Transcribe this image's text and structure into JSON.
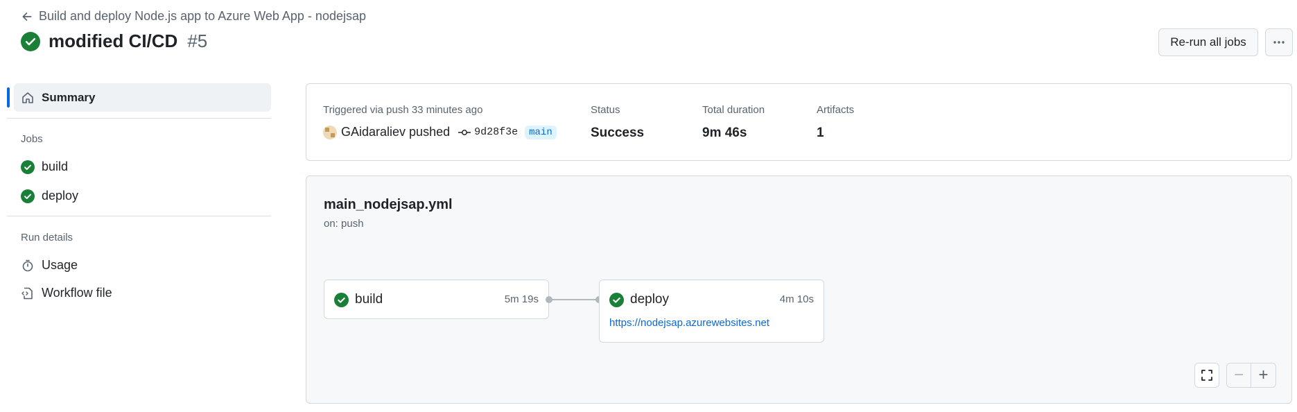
{
  "header": {
    "back_link_text": "Build and deploy Node.js app to Azure Web App - nodejsap",
    "run_title": "modified CI/CD",
    "run_number": "#5",
    "rerun_label": "Re-run all jobs",
    "more_icon": "kebab-horizontal-icon"
  },
  "sidebar": {
    "summary_label": "Summary",
    "jobs_heading": "Jobs",
    "jobs": [
      {
        "label": "build",
        "status": "success"
      },
      {
        "label": "deploy",
        "status": "success"
      }
    ],
    "run_details_heading": "Run details",
    "details": [
      {
        "label": "Usage",
        "icon": "stopwatch-icon"
      },
      {
        "label": "Workflow file",
        "icon": "file-code-icon"
      }
    ]
  },
  "summary": {
    "trigger_text": "Triggered via push 33 minutes ago",
    "actor_text": "GAidaraliev pushed",
    "commit_sha": "9d28f3e",
    "branch": "main",
    "status_label": "Status",
    "status_value": "Success",
    "duration_label": "Total duration",
    "duration_value": "9m 46s",
    "artifacts_label": "Artifacts",
    "artifacts_value": "1"
  },
  "workflow": {
    "file_name": "main_nodejsap.yml",
    "trigger": "on: push",
    "jobs": [
      {
        "name": "build",
        "duration": "5m 19s"
      },
      {
        "name": "deploy",
        "duration": "4m 10s",
        "url": "https://nodejsap.azurewebsites.net"
      }
    ],
    "zoom_out": "−",
    "zoom_in": "+"
  },
  "colors": {
    "success": "#1a7f37",
    "accent": "#0969da",
    "muted": "#59636e"
  }
}
